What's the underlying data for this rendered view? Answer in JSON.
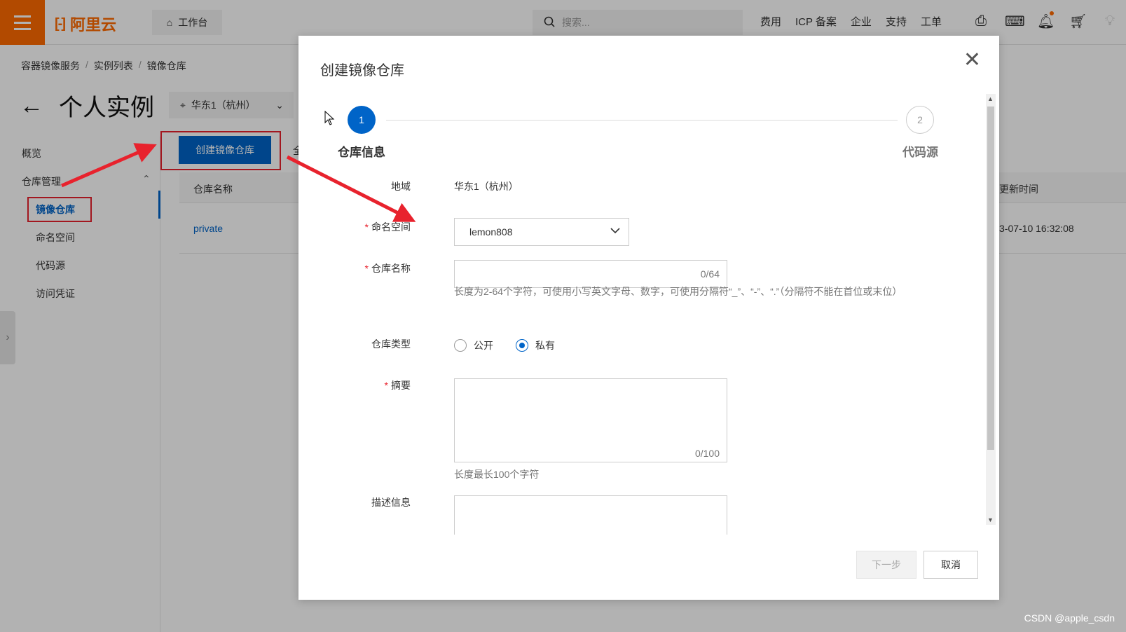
{
  "topbar": {
    "logo_text": "阿里云",
    "logo_mark": "[-]",
    "workbench_label": "工作台",
    "search_placeholder": "搜索...",
    "nav_items": [
      "费用",
      "ICP 备案",
      "企业",
      "支持",
      "工单"
    ]
  },
  "breadcrumb": [
    "容器镜像服务",
    "实例列表",
    "镜像仓库"
  ],
  "page": {
    "title": "个人实例",
    "region": "华东1（杭州）"
  },
  "sidebar": {
    "overview": "概览",
    "repo_mgmt": "仓库管理",
    "items": [
      "镜像仓库",
      "命名空间",
      "代码源",
      "访问凭证"
    ]
  },
  "toolbar": {
    "create_label": "创建镜像仓库",
    "partial_label": "全"
  },
  "table": {
    "col_name": "仓库名称",
    "col_updated": "更新时间",
    "rows": [
      {
        "name": "private",
        "updated": "3-07-10 16:32:08"
      }
    ]
  },
  "modal": {
    "title": "创建镜像仓库",
    "steps": [
      {
        "num": "1",
        "label": "仓库信息"
      },
      {
        "num": "2",
        "label": "代码源"
      }
    ],
    "region_label": "地域",
    "region_value": "华东1（杭州）",
    "namespace_label": "命名空间",
    "namespace_value": "lemon808",
    "repo_name_label": "仓库名称",
    "repo_name_counter": "0/64",
    "repo_name_hint": "长度为2-64个字符，可使用小写英文字母、数字，可使用分隔符“_”、“-”、“.”（分隔符不能在首位或末位）",
    "repo_type_label": "仓库类型",
    "repo_type_public": "公开",
    "repo_type_private": "私有",
    "repo_type_selected": "私有",
    "summary_label": "摘要",
    "summary_counter": "0/100",
    "summary_hint": "长度最长100个字符",
    "desc_label": "描述信息",
    "next_label": "下一步",
    "cancel_label": "取消"
  },
  "watermark": "CSDN @apple_csdn",
  "colors": {
    "brand": "#ff6a00",
    "primary": "#0064c8",
    "annotation": "#e8222d"
  }
}
